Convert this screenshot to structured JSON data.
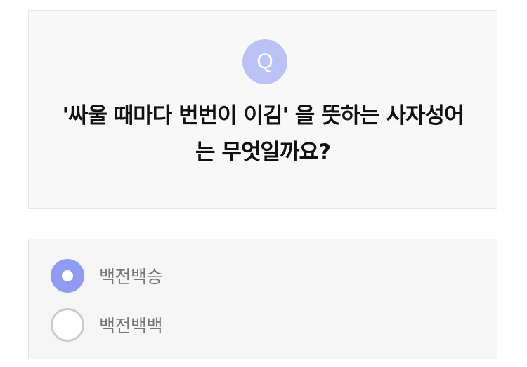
{
  "question": {
    "badge": "Q",
    "line1": "'싸울 때마다 번번이 이김' 을 뜻하는 사자성어",
    "line2": "는 무엇일까요?"
  },
  "options": [
    {
      "label": "백전백승",
      "selected": true
    },
    {
      "label": "백전백백",
      "selected": false
    }
  ],
  "colors": {
    "badge_bg": "#bcc2f6",
    "radio_selected": "#8f9cf2",
    "radio_unselected_border": "#cccccc",
    "card_bg": "#f8f8f8",
    "question_text": "#111111",
    "option_text": "#777777"
  }
}
